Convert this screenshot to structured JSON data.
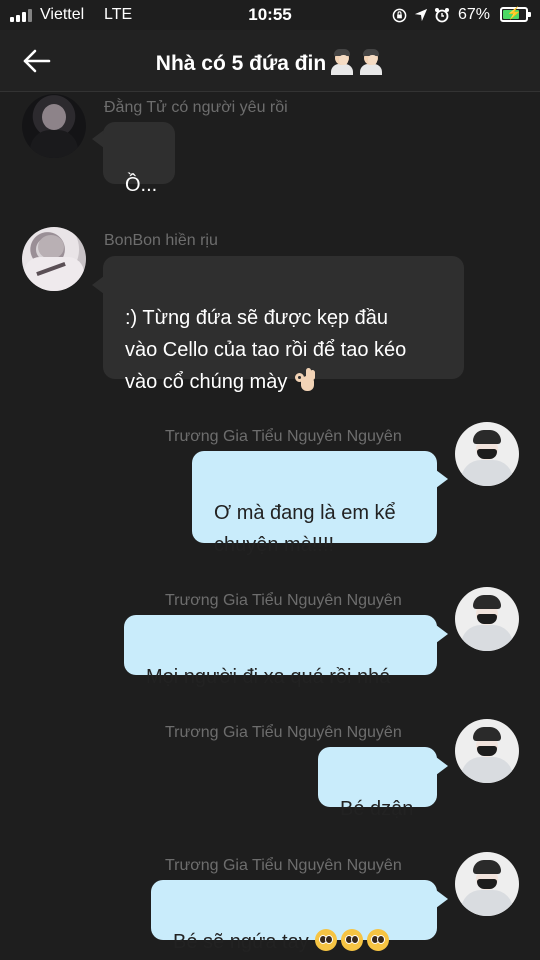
{
  "status_bar": {
    "carrier": "Viettel",
    "network": "LTE",
    "time": "10:55",
    "battery_percent": "67%",
    "battery_level": 0.67,
    "icons": [
      "signal-icon",
      "screen-lock-icon",
      "location-icon",
      "alarm-icon",
      "battery-charging-icon"
    ]
  },
  "header": {
    "title": "Nhà có 5 đứa đin",
    "title_emoji": [
      "facepalm-icon",
      "facepalm-icon"
    ]
  },
  "messages": [
    {
      "sender": "Đằng Tử có người yêu rồi",
      "text": "Ồ...",
      "direction": "in",
      "avatar": "avatar-dark"
    },
    {
      "sender": "BonBon hiền rịu",
      "text": ":) Từng đứa sẽ được kẹp đầu\nvào Cello của tao rồi để tao kéo\nvào cổ chúng mày",
      "emoji": "ok-hand-icon",
      "direction": "in",
      "avatar": "avatar-light"
    },
    {
      "sender": "Trương Gia Tiểu Nguyên Nguyên",
      "text": "Ơ mà đang là em kể\nchuyện mà!!!!",
      "direction": "out",
      "avatar": "avatar-me"
    },
    {
      "sender": "Trương Gia Tiểu Nguyên Nguyên",
      "text": "Mọi người đi xa quá rồi nhá",
      "direction": "out",
      "avatar": "avatar-me"
    },
    {
      "sender": "Trương Gia Tiểu Nguyên Nguyên",
      "text": "Bé dzận",
      "direction": "out",
      "avatar": "avatar-me"
    },
    {
      "sender": "Trương Gia Tiểu Nguyên Nguyên",
      "text": "Bé sẽ ngứa tay",
      "emoji": "pleading-face-icon",
      "emoji_count": 3,
      "direction": "out",
      "avatar": "avatar-me"
    }
  ],
  "colors": {
    "background": "#1e1e1e",
    "incoming_bubble": "#2f2f2f",
    "outgoing_bubble": "#c9ecfb",
    "sender_name": "#6d6d6d"
  }
}
